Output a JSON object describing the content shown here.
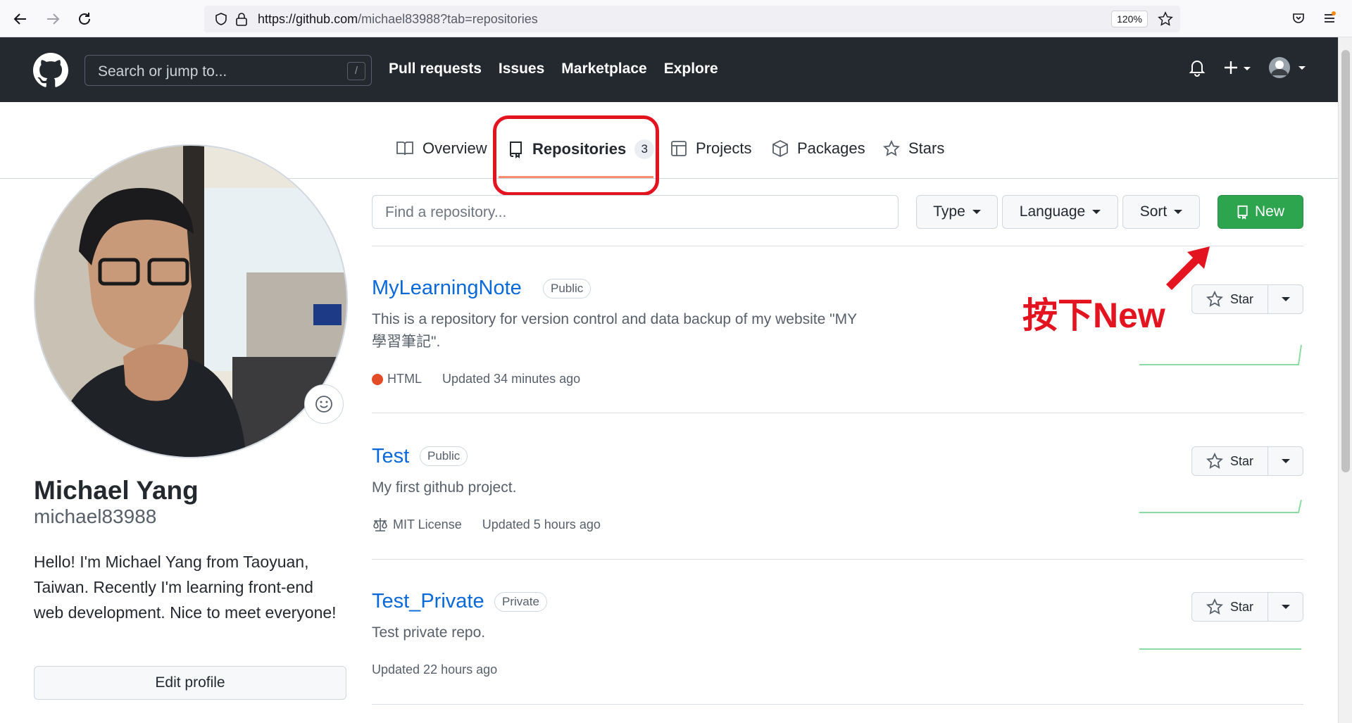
{
  "browser": {
    "url_host": "https://github.com",
    "url_path": "/michael83988?tab=repositories",
    "zoom": "120%"
  },
  "header": {
    "search_placeholder": "Search or jump to...",
    "search_key": "/",
    "nav": [
      "Pull requests",
      "Issues",
      "Marketplace",
      "Explore"
    ]
  },
  "tabs": {
    "overview": "Overview",
    "repositories": "Repositories",
    "repositories_count": "3",
    "projects": "Projects",
    "packages": "Packages",
    "stars": "Stars"
  },
  "profile": {
    "name": "Michael Yang",
    "login": "michael83988",
    "bio": "Hello! I'm Michael Yang from Taoyuan, Taiwan. Recently I'm learning front-end web development. Nice to meet everyone!",
    "edit_label": "Edit profile"
  },
  "filters": {
    "find_placeholder": "Find a repository...",
    "type_label": "Type",
    "language_label": "Language",
    "sort_label": "Sort",
    "new_label": "New"
  },
  "repos": [
    {
      "name": "MyLearningNote",
      "visibility": "Public",
      "description": "This is a repository for version control and data backup of my website \"MY 學習筆記\".",
      "language": "HTML",
      "updated": "Updated 34 minutes ago",
      "star_label": "Star"
    },
    {
      "name": "Test",
      "visibility": "Public",
      "description": "My first github project.",
      "license": "MIT License",
      "updated": "Updated 5 hours ago",
      "star_label": "Star"
    },
    {
      "name": "Test_Private",
      "visibility": "Private",
      "description": "Test private repo.",
      "updated": "Updated 22 hours ago",
      "star_label": "Star"
    }
  ],
  "annotation": {
    "text": "按下New"
  },
  "colors": {
    "header_bg": "#24292f",
    "new_button": "#2da44e",
    "link": "#0969da",
    "annotation_red": "#e3141f",
    "html_lang": "#e34c26"
  }
}
